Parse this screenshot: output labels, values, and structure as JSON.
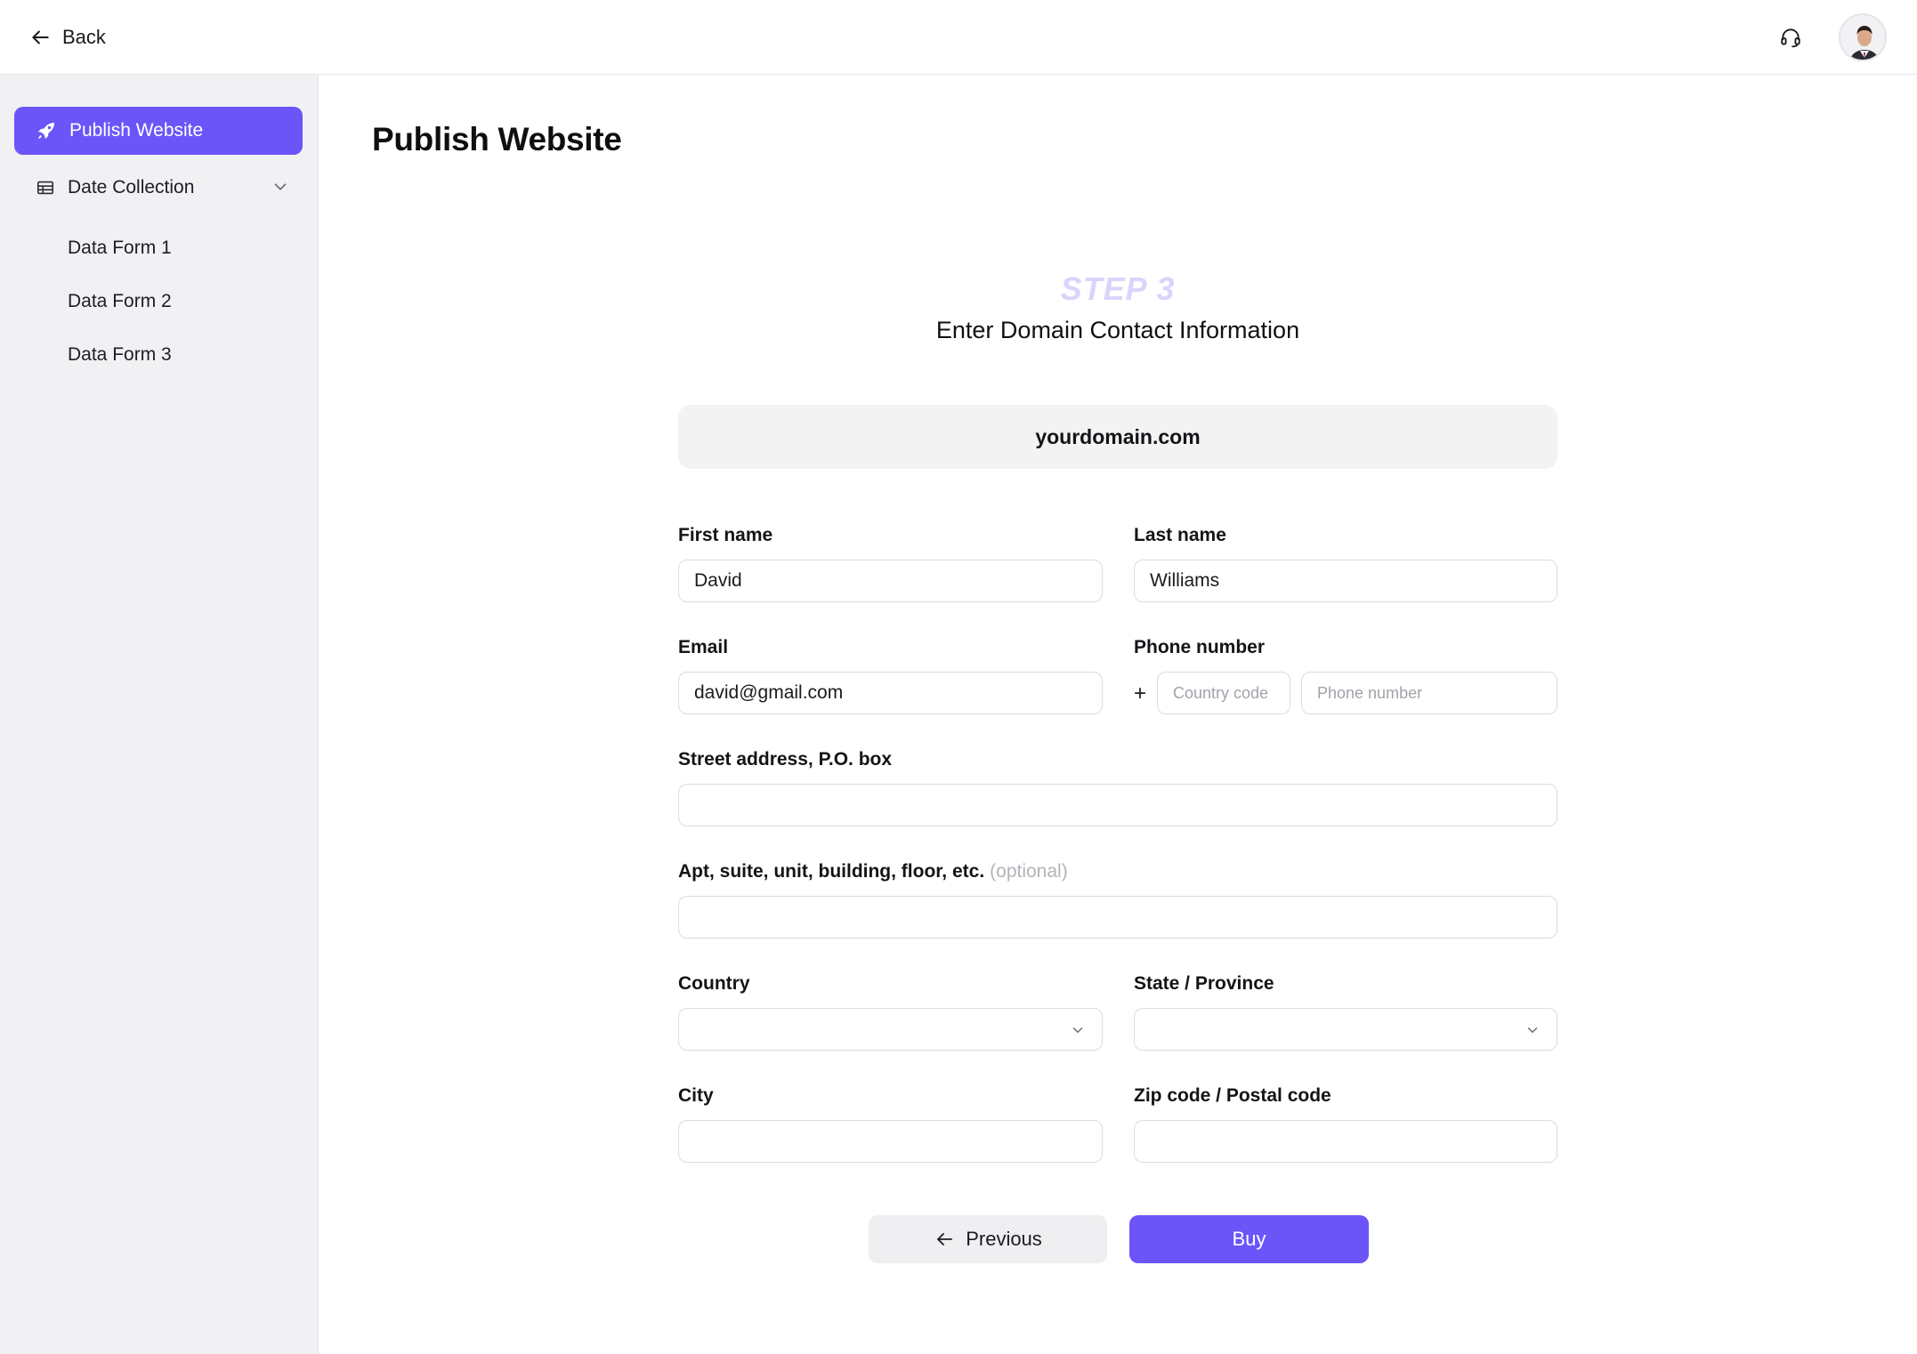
{
  "topbar": {
    "back_label": "Back",
    "support_icon": "headset-icon",
    "avatar_icon": "user-avatar"
  },
  "sidebar": {
    "active_item": {
      "label": "Publish Website",
      "icon": "rocket-icon"
    },
    "group": {
      "label": "Date Collection",
      "icon": "table-icon",
      "expanded": true
    },
    "sub_items": [
      {
        "label": "Data Form 1"
      },
      {
        "label": "Data Form 2"
      },
      {
        "label": "Data Form 3"
      }
    ]
  },
  "main": {
    "title": "Publish Website",
    "step_label": "STEP 3",
    "step_title": "Enter Domain Contact Information",
    "domain": "yourdomain.com",
    "form": {
      "first_name": {
        "label": "First name",
        "value": "David"
      },
      "last_name": {
        "label": "Last name",
        "value": "Williams"
      },
      "email": {
        "label": "Email",
        "value": "david@gmail.com"
      },
      "phone": {
        "label": "Phone number",
        "prefix": "+",
        "country_code_placeholder": "Country code",
        "number_placeholder": "Phone number"
      },
      "street": {
        "label": "Street address, P.O. box",
        "value": ""
      },
      "apt": {
        "label": "Apt, suite, unit, building, floor, etc.",
        "optional": "(optional)",
        "value": ""
      },
      "country": {
        "label": "Country",
        "value": ""
      },
      "state": {
        "label": "State / Province",
        "value": ""
      },
      "city": {
        "label": "City",
        "value": ""
      },
      "zip": {
        "label": "Zip code / Postal code",
        "value": ""
      }
    },
    "buttons": {
      "previous_label": "Previous",
      "buy_label": "Buy"
    }
  },
  "colors": {
    "accent": "#6b55f8",
    "step_label": "#d9d4fb",
    "sidebar_bg": "#f1f1f3"
  }
}
